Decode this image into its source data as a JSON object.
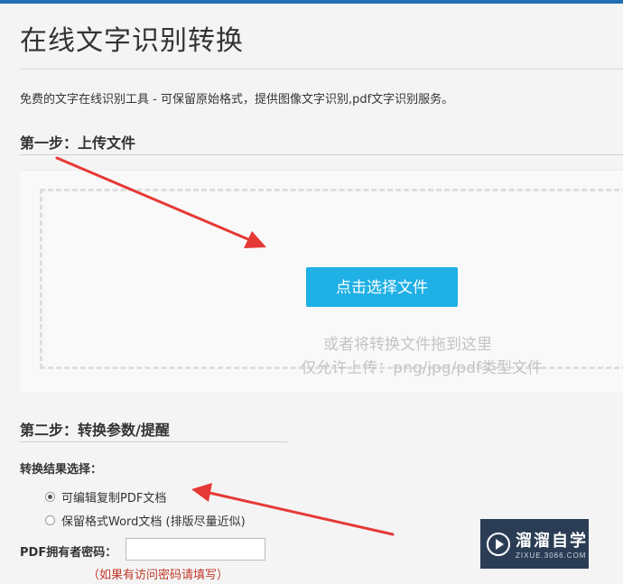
{
  "page": {
    "title": "在线文字识别转换",
    "description": "免费的文字在线识别工具 - 可保留原始格式，提供图像文字识别,pdf文字识别服务。"
  },
  "step1": {
    "heading": "第一步：上传文件",
    "choose_button": "点击选择文件",
    "drop_hint": "或者将转换文件拖到这里",
    "allowed_types": "仅允许上传：png/jpg/pdf类型文件"
  },
  "step2": {
    "heading": "第二步：转换参数/提醒",
    "result_label": "转换结果选择：",
    "options": [
      {
        "label": "可编辑复制PDF文档",
        "selected": true
      },
      {
        "label": "保留格式Word文档 (排版尽量近似)",
        "selected": false
      }
    ],
    "password_label": "PDF拥有者密码：",
    "password_value": "",
    "password_note": "（如果有访问密码请填写）"
  },
  "watermark": {
    "name": "溜溜自学",
    "domain": "ZIXUE.3066.COM"
  },
  "colors": {
    "accent": "#1fb0e6",
    "topbar": "#1f6fb2",
    "annotation_arrow": "#e53935",
    "note_red": "#c0392b"
  }
}
